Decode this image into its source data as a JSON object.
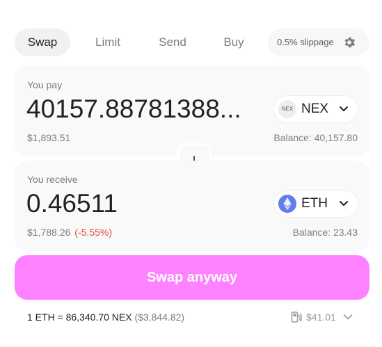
{
  "tabs": [
    {
      "label": "Swap",
      "active": true
    },
    {
      "label": "Limit",
      "active": false
    },
    {
      "label": "Send",
      "active": false
    },
    {
      "label": "Buy",
      "active": false
    }
  ],
  "slippage": {
    "label": "0.5% slippage",
    "icon": "gear-icon"
  },
  "pay": {
    "label": "You pay",
    "amount": "40157.88781388...",
    "usd": "$1,893.51",
    "balance": "Balance: 40,157.80",
    "token": {
      "symbol": "NEX",
      "logo_text": "NEX"
    }
  },
  "receive": {
    "label": "You receive",
    "amount": "0.46511",
    "usd": "$1,788.26",
    "price_impact": "(-5.55%)",
    "balance": "Balance: 23.43",
    "token": {
      "symbol": "ETH",
      "logo": "eth-logo"
    }
  },
  "swap_button": {
    "label": "Swap anyway"
  },
  "rate": {
    "text": "1 ETH = 86,340.70 NEX",
    "usd": "($3,844.82)"
  },
  "gas": {
    "value": "$41.01",
    "icon": "gas-pump-icon"
  },
  "colors": {
    "accent": "#fd82ff",
    "negative": "#e2493a",
    "eth": "#627eea"
  }
}
